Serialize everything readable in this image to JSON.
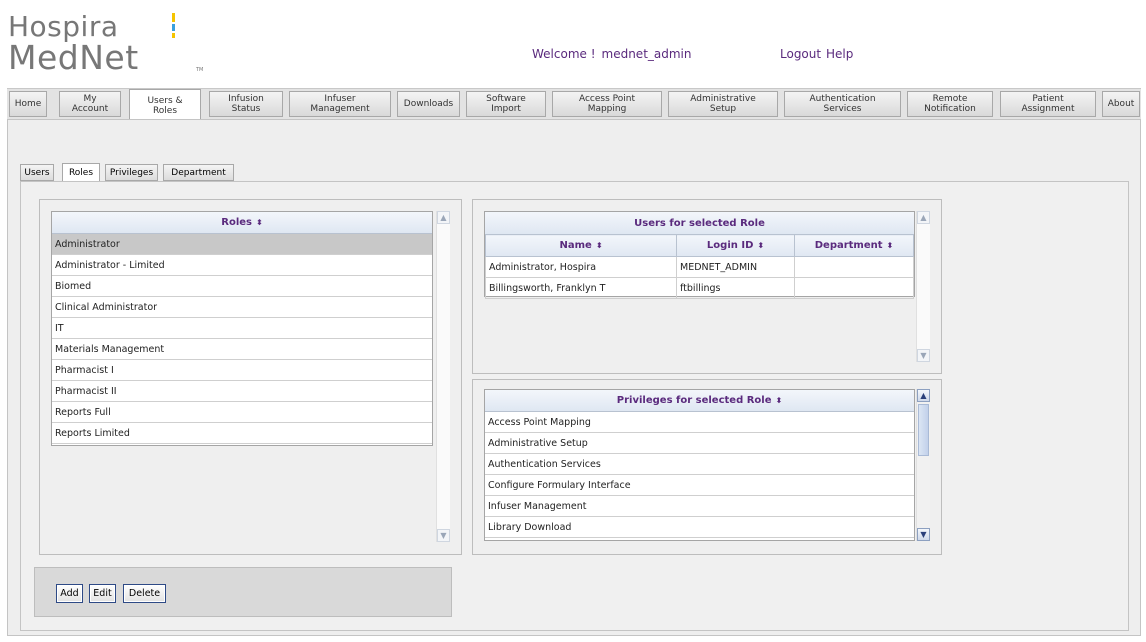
{
  "header": {
    "logo_line1": "Hospira",
    "logo_line2": "MedNet",
    "logo_tm": "TM",
    "welcome": "Welcome !",
    "username": "mednet_admin",
    "logout": "Logout",
    "help": "Help"
  },
  "nav": {
    "tabs": [
      {
        "l1": "Home",
        "l2": ""
      },
      {
        "l1": "My",
        "l2": "Account"
      },
      {
        "l1": "Users &",
        "l2": "Roles"
      },
      {
        "l1": "Infusion",
        "l2": "Status"
      },
      {
        "l1": "Infuser",
        "l2": "Management"
      },
      {
        "l1": "Downloads",
        "l2": ""
      },
      {
        "l1": "Software",
        "l2": "Import"
      },
      {
        "l1": "Access Point",
        "l2": "Mapping"
      },
      {
        "l1": "Administrative",
        "l2": "Setup"
      },
      {
        "l1": "Authentication",
        "l2": "Services"
      },
      {
        "l1": "Remote",
        "l2": "Notification"
      },
      {
        "l1": "Patient",
        "l2": "Assignment"
      },
      {
        "l1": "About",
        "l2": ""
      }
    ],
    "active": "Users & Roles"
  },
  "subtabs": [
    "Users",
    "Roles",
    "Privileges",
    "Department"
  ],
  "active_subtab": "Roles",
  "roles": {
    "header": "Roles",
    "sort_icon": "sort-arrows-icon",
    "items": [
      "Administrator",
      "Administrator - Limited",
      "Biomed",
      "Clinical Administrator",
      "IT",
      "Materials Management",
      "Pharmacist I",
      "Pharmacist II",
      "Reports Full",
      "Reports Limited"
    ],
    "selected": "Administrator"
  },
  "users_for_role": {
    "title": "Users for selected Role",
    "columns": [
      "Name",
      "Login ID",
      "Department"
    ],
    "rows": [
      [
        "Administrator, Hospira",
        "MEDNET_ADMIN",
        ""
      ],
      [
        "Billingsworth, Franklyn T",
        "ftbillings",
        ""
      ]
    ]
  },
  "privileges": {
    "header": "Privileges for selected Role",
    "items": [
      "Access Point Mapping",
      "Administrative Setup",
      "Authentication Services",
      "Configure Formulary Interface",
      "Infuser Management",
      "Library Download"
    ]
  },
  "buttons": {
    "add": "Add",
    "edit": "Edit",
    "delete": "Delete"
  },
  "colors": {
    "accent_purple": "#5a2a7d",
    "selected_row": "#c8c8c8",
    "button_border": "#2e4a86"
  },
  "sort_glyph": "⬍"
}
